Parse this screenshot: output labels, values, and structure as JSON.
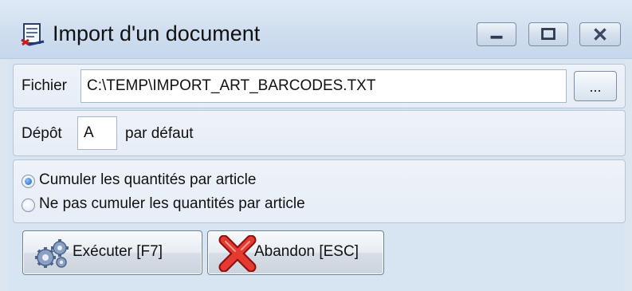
{
  "window": {
    "title": "Import d'un document",
    "icon": "document-scanner-icon",
    "controls": [
      "minimize-icon",
      "maximize-icon",
      "close-icon"
    ]
  },
  "file_row": {
    "label": "Fichier",
    "value": "C:\\TEMP\\IMPORT_ART_BARCODES.TXT",
    "browse_label": "..."
  },
  "depot_row": {
    "label": "Dépôt",
    "value": "A",
    "suffix": "par défaut"
  },
  "options": [
    {
      "label": "Cumuler les quantités par article",
      "checked": true
    },
    {
      "label": "Ne pas cumuler les quantités par article",
      "checked": false
    }
  ],
  "buttons": {
    "execute": {
      "label": "Exécuter [F7]",
      "icon": "gears-icon"
    },
    "cancel": {
      "label": "Abandon [ESC]",
      "icon": "red-x-icon"
    }
  }
}
